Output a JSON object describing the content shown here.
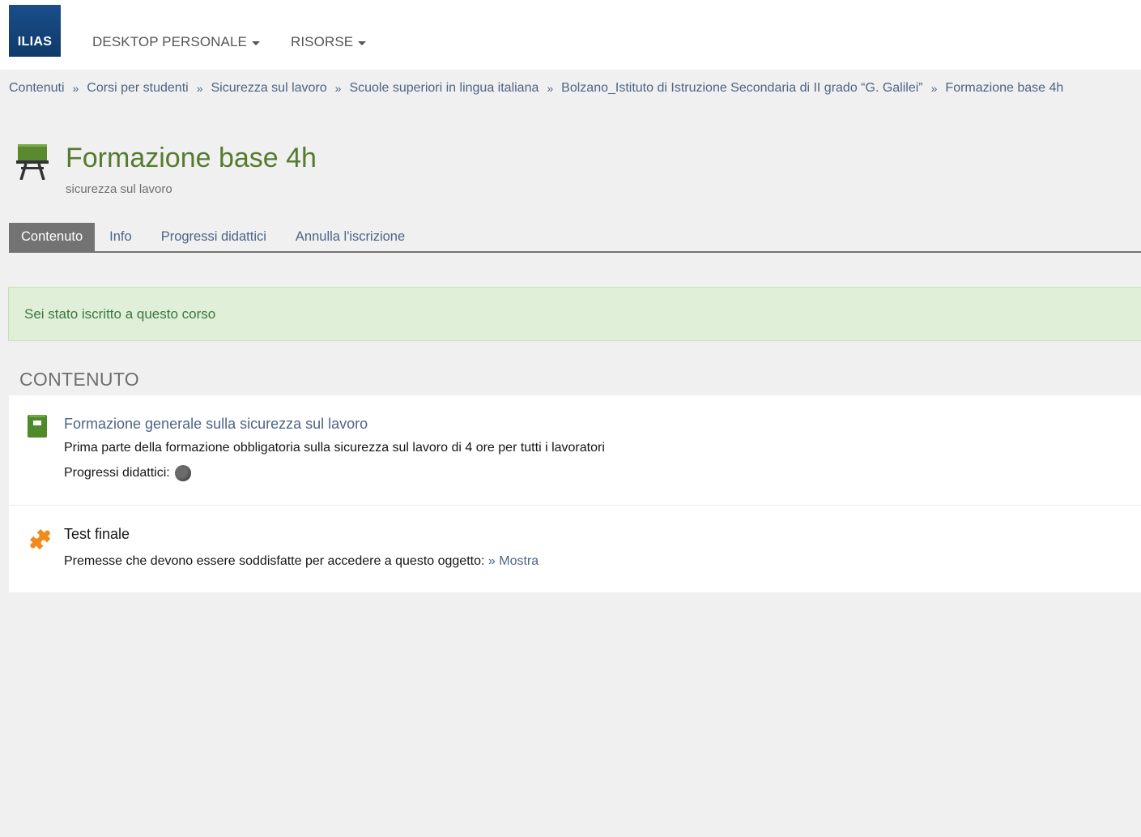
{
  "header": {
    "logo_text": "ILIAS",
    "nav": [
      {
        "label": "DESKTOP PERSONALE"
      },
      {
        "label": "RISORSE"
      }
    ]
  },
  "breadcrumb": [
    "Contenuti",
    "Corsi per studenti",
    "Sicurezza sul lavoro",
    "Scuole superiori in lingua italiana",
    "Bolzano_Istituto di Istruzione Secondaria di II grado “G. Galilei”",
    "Formazione base 4h"
  ],
  "breadcrumb_separator": "»",
  "page": {
    "title": "Formazione base 4h",
    "subtitle": "sicurezza sul lavoro",
    "title_icon": "course-easel-icon"
  },
  "tabs": [
    {
      "label": "Contenuto",
      "active": true
    },
    {
      "label": "Info",
      "active": false
    },
    {
      "label": "Progressi didattici",
      "active": false
    },
    {
      "label": "Annulla l'iscrizione",
      "active": false
    }
  ],
  "message": {
    "text": "Sei stato iscritto a questo corso",
    "type": "success"
  },
  "section": {
    "title": "CONTENUTO"
  },
  "items": [
    {
      "title": "Formazione generale sulla sicurezza sul lavoro",
      "description": "Prima parte della formazione obbligatoria sulla sicurezza sul lavoro di 4 ore per tutti i lavoratori",
      "progress_label": "Progressi didattici:",
      "icon": "learning-module-book-icon"
    },
    {
      "title": "Test finale",
      "prereq_label": "Premesse che devono essere soddisfatte per accedere a questo oggetto:",
      "prereq_link": "» Mostra",
      "icon": "test-puzzle-icon"
    }
  ],
  "colors": {
    "title_green": "#557b2e",
    "link_blue": "#4c6586",
    "tab_active_bg": "#737373",
    "success_bg": "#dfefd8",
    "success_text": "#3c763d",
    "logo_blue": "#0f3a6b"
  }
}
